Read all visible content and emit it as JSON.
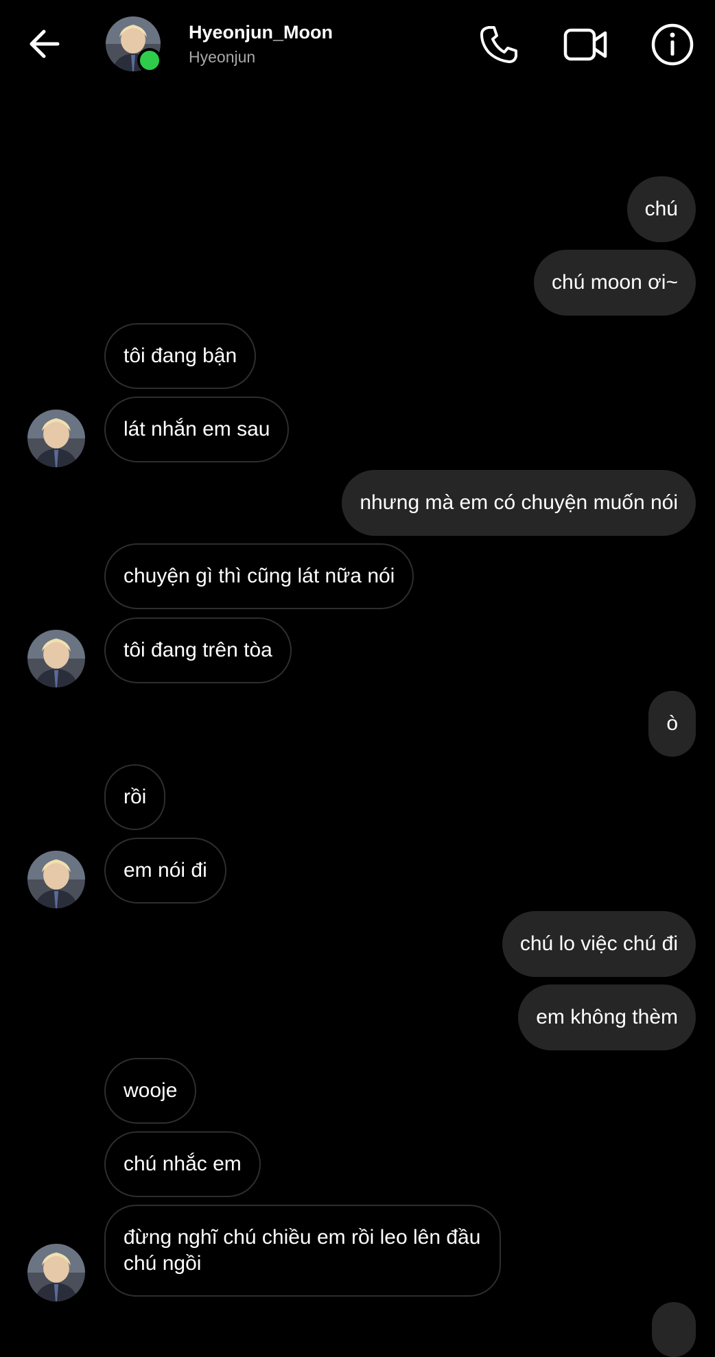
{
  "header": {
    "name": "Hyeonjun_Moon",
    "subtitle": "Hyeonjun",
    "online_color": "#2ecc4a"
  },
  "icons": {
    "back": "arrow-left-icon",
    "call": "phone-icon",
    "video": "video-camera-icon",
    "info": "info-icon"
  },
  "messages": [
    {
      "from": "me",
      "text": "chú"
    },
    {
      "from": "me",
      "text": "chú moon ơi~"
    },
    {
      "from": "them",
      "text": "tôi đang bận"
    },
    {
      "from": "them",
      "text": "lát nhắn em sau"
    },
    {
      "from": "me",
      "text": "nhưng mà em có chuyện muốn nói"
    },
    {
      "from": "them",
      "text": "chuyện gì thì cũng lát nữa nói"
    },
    {
      "from": "them",
      "text": "tôi đang trên tòa"
    },
    {
      "from": "me",
      "text": "ò"
    },
    {
      "from": "them",
      "text": "rồi"
    },
    {
      "from": "them",
      "text": "em nói đi"
    },
    {
      "from": "me",
      "text": "chú lo việc chú đi"
    },
    {
      "from": "me",
      "text": "em không thèm"
    },
    {
      "from": "them",
      "text": "wooje"
    },
    {
      "from": "them",
      "text": "chú nhắc em"
    },
    {
      "from": "them",
      "text": "đừng nghĩ chú chiều em rồi leo lên đầu chú ngồi"
    }
  ],
  "colors": {
    "background": "#000000",
    "outgoing_bubble": "#262626",
    "incoming_border": "#2e2e2e",
    "text": "#ffffff",
    "subtitle": "#a8a8a8"
  }
}
